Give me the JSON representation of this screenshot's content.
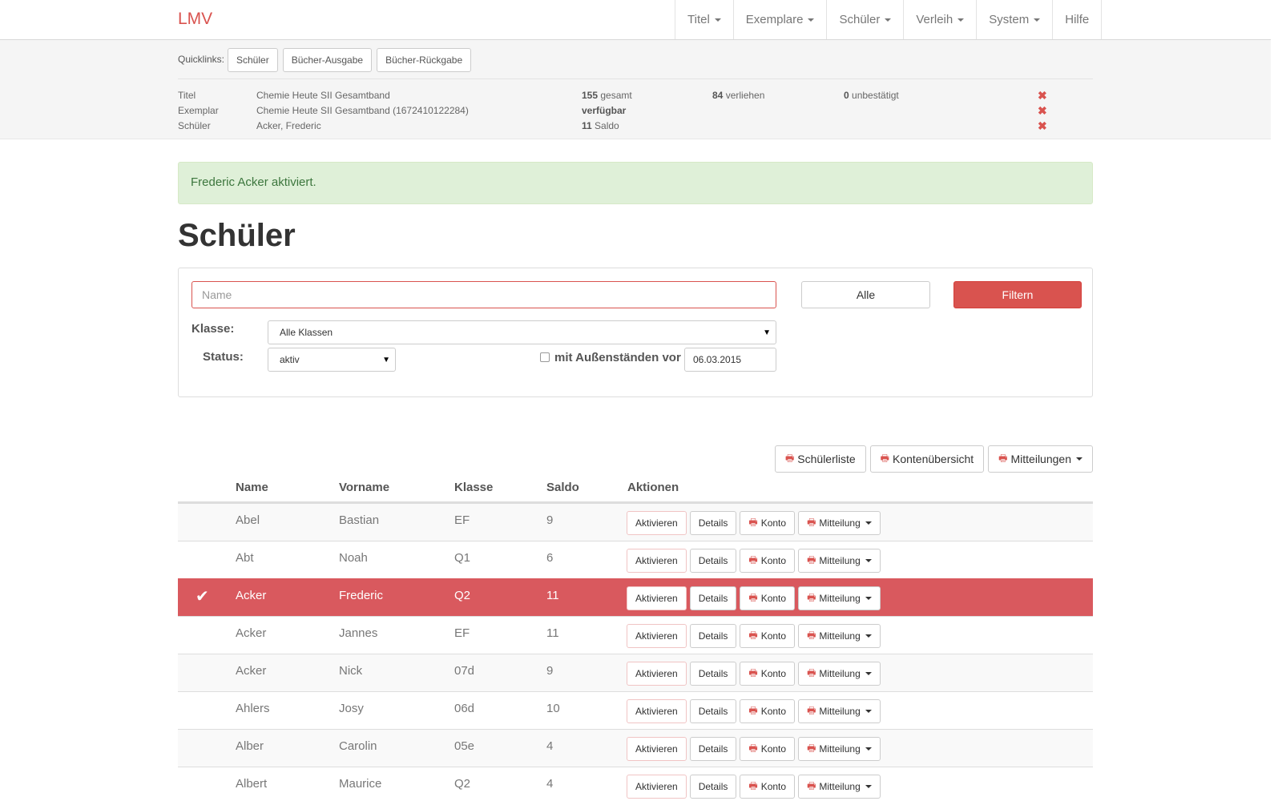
{
  "brand": "LMV",
  "nav": [
    {
      "label": "Titel",
      "dropdown": true
    },
    {
      "label": "Exemplare",
      "dropdown": true
    },
    {
      "label": "Schüler",
      "dropdown": true
    },
    {
      "label": "Verleih",
      "dropdown": true
    },
    {
      "label": "System",
      "dropdown": true
    },
    {
      "label": "Hilfe",
      "dropdown": false
    }
  ],
  "quicklinks": {
    "label": "Quicklinks:",
    "items": [
      "Schüler",
      "Bücher-Ausgabe",
      "Bücher-Rückgabe"
    ]
  },
  "info": {
    "titel": {
      "label": "Titel",
      "value": "Chemie Heute SII Gesamtband",
      "gesamt_num": "155",
      "gesamt_text": "gesamt",
      "verliehen_num": "84",
      "verliehen_text": "verliehen",
      "unbestaetigt_num": "0",
      "unbestaetigt_text": "unbestätigt"
    },
    "exemplar": {
      "label": "Exemplar",
      "value": "Chemie Heute SII Gesamtband (1672410122284)",
      "status": "verfügbar"
    },
    "schueler": {
      "label": "Schüler",
      "value": "Acker, Frederic",
      "saldo_num": "11",
      "saldo_text": "Saldo"
    }
  },
  "alert": "Frederic Acker aktiviert.",
  "page_title": "Schüler",
  "filter": {
    "name_placeholder": "Name",
    "alle_label": "Alle",
    "filtern_label": "Filtern",
    "klasse_label": "Klasse:",
    "klasse_value": "Alle Klassen",
    "status_label": "Status:",
    "status_value": "aktiv",
    "aussenstaende_label": "mit Außenständen vor",
    "date_value": "06.03.2015"
  },
  "toolbar": {
    "schuelerliste": "Schülerliste",
    "kontenuebersicht": "Kontenübersicht",
    "mitteilungen": "Mitteilungen"
  },
  "table": {
    "headers": {
      "name": "Name",
      "vorname": "Vorname",
      "klasse": "Klasse",
      "saldo": "Saldo",
      "aktionen": "Aktionen"
    },
    "action_labels": {
      "aktivieren": "Aktivieren",
      "details": "Details",
      "konto": "Konto",
      "mitteilung": "Mitteilung"
    },
    "rows": [
      {
        "name": "Abel",
        "vorname": "Bastian",
        "klasse": "EF",
        "saldo": "9",
        "active": false
      },
      {
        "name": "Abt",
        "vorname": "Noah",
        "klasse": "Q1",
        "saldo": "6",
        "active": false
      },
      {
        "name": "Acker",
        "vorname": "Frederic",
        "klasse": "Q2",
        "saldo": "11",
        "active": true
      },
      {
        "name": "Acker",
        "vorname": "Jannes",
        "klasse": "EF",
        "saldo": "11",
        "active": false
      },
      {
        "name": "Acker",
        "vorname": "Nick",
        "klasse": "07d",
        "saldo": "9",
        "active": false
      },
      {
        "name": "Ahlers",
        "vorname": "Josy",
        "klasse": "06d",
        "saldo": "10",
        "active": false
      },
      {
        "name": "Alber",
        "vorname": "Carolin",
        "klasse": "05e",
        "saldo": "4",
        "active": false
      },
      {
        "name": "Albert",
        "vorname": "Maurice",
        "klasse": "Q2",
        "saldo": "4",
        "active": false
      }
    ]
  }
}
